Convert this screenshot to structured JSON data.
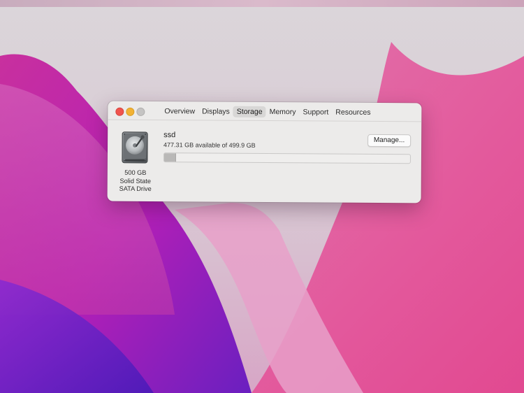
{
  "window": {
    "tabs": [
      {
        "label": "Overview",
        "active": false
      },
      {
        "label": "Displays",
        "active": false
      },
      {
        "label": "Storage",
        "active": true
      },
      {
        "label": "Memory",
        "active": false
      },
      {
        "label": "Support",
        "active": false
      },
      {
        "label": "Resources",
        "active": false
      }
    ]
  },
  "storage": {
    "disk_icon": "hard-drive-icon",
    "disk_caption": [
      "500 GB",
      "Solid State",
      "SATA Drive"
    ],
    "volume_name": "ssd",
    "available_text": "477.31 GB available of 499.9 GB",
    "manage_label": "Manage...",
    "used_fraction": 0.045
  },
  "colors": {
    "close": "#f0534d",
    "minimize": "#f2b233",
    "zoom_disabled": "#c5c4c3",
    "window_bg": "#ecebea",
    "wallpaper_magenta": "#c92fb0",
    "wallpaper_pink": "#e86aa8",
    "wallpaper_purple": "#5a1fb5"
  }
}
